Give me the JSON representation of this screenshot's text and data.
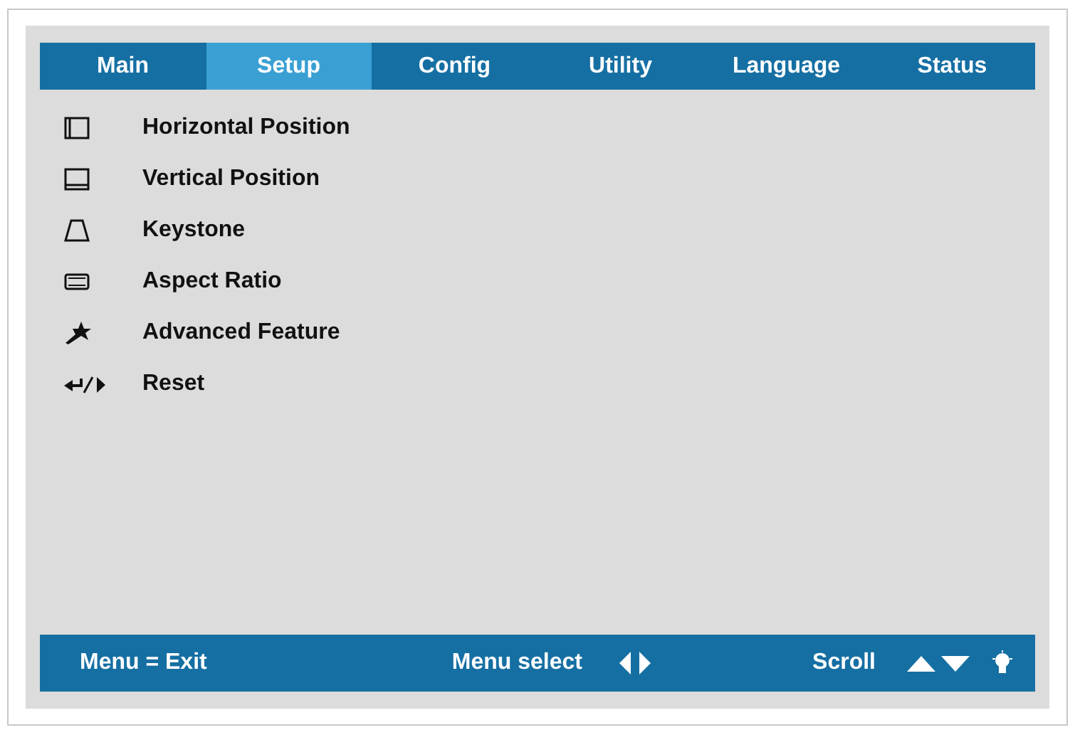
{
  "tabs": [
    {
      "label": "Main",
      "selected": false
    },
    {
      "label": "Setup",
      "selected": true
    },
    {
      "label": "Config",
      "selected": false
    },
    {
      "label": "Utility",
      "selected": false
    },
    {
      "label": "Language",
      "selected": false
    },
    {
      "label": "Status",
      "selected": false
    }
  ],
  "menu_items": [
    {
      "kind": "horizontal",
      "label": "Horizontal Position"
    },
    {
      "kind": "vertical",
      "label": "Vertical Position"
    },
    {
      "kind": "keystone",
      "label": "Keystone"
    },
    {
      "kind": "aspect",
      "label": "Aspect Ratio"
    },
    {
      "kind": "advanced",
      "label": "Advanced Feature"
    },
    {
      "kind": "reset",
      "label": "Reset"
    }
  ],
  "footer": {
    "exit_hint": "Menu = Exit",
    "select_hint": "Menu select",
    "scroll_hint": "Scroll"
  }
}
